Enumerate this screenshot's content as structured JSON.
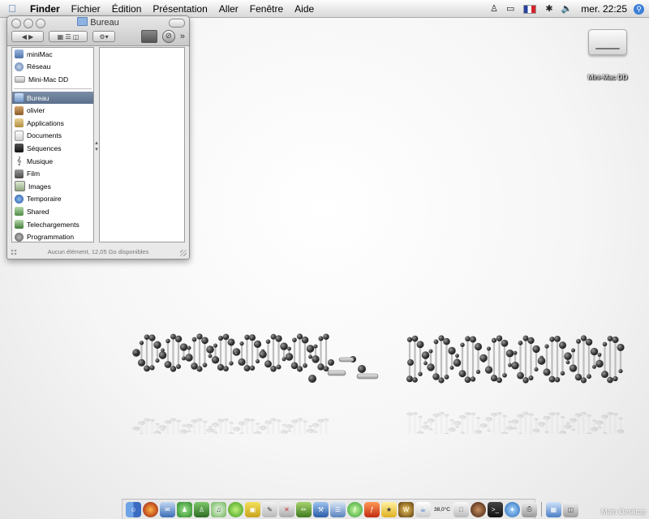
{
  "menubar": {
    "apple_icon": "apple-icon",
    "app_name": "Finder",
    "menus": [
      "Fichier",
      "Édition",
      "Présentation",
      "Aller",
      "Fenêtre",
      "Aide"
    ],
    "clock": "mer. 22:25"
  },
  "finder_window": {
    "title": "Bureau",
    "devices": [
      "miniMac",
      "Réseau",
      "Mini-Mac DD"
    ],
    "places": [
      "Bureau",
      "olivier",
      "Applications",
      "Documents",
      "Séquences",
      "Musique",
      "Film",
      "Images",
      "Temporaire",
      "Shared",
      "Telechargements",
      "Programmation"
    ],
    "selected_place": "Bureau",
    "status": "Aucun élément, 12,05 Go disponibles"
  },
  "desktop": {
    "drive_label": "Mini-Mac DD",
    "corner_label": "Main Desktop"
  },
  "dock": {
    "temperature": "38,0°C"
  },
  "colors": {
    "selection": "#5b6f8c",
    "spotlight": "#3b7fd8"
  }
}
